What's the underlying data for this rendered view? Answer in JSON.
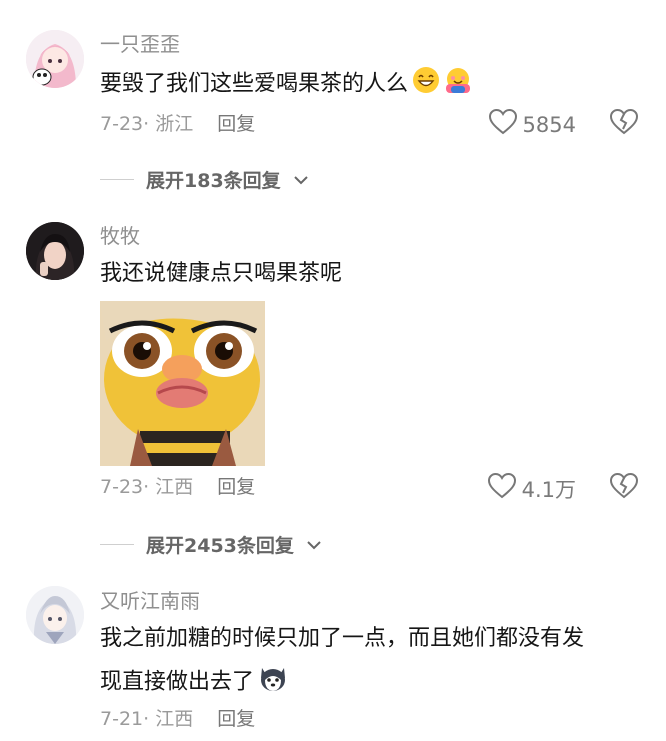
{
  "comments": [
    {
      "username": "一只歪歪",
      "text": "要毁了我们这些爱喝果茶的人么",
      "date": "7-23",
      "location": "浙江",
      "reply_label": "回复",
      "likes": "5854",
      "expand_label": "展开183条回复"
    },
    {
      "username": "牧牧",
      "text": "我还说健康点只喝果茶呢",
      "date": "7-23",
      "location": "江西",
      "reply_label": "回复",
      "likes": "4.1万",
      "expand_label": "展开2453条回复"
    },
    {
      "username": "又听江南雨",
      "text_line1": "我之前加糖的时候只加了一点，而且她们都没有发",
      "text_line2": "现直接做出去了",
      "date": "7-21",
      "location": "江西",
      "reply_label": "回复"
    }
  ],
  "icons": {
    "like": "heart-outline-icon",
    "dislike": "broken-heart-icon",
    "expand": "chevron-down-icon"
  },
  "colors": {
    "text": "#161616",
    "meta": "#9a9a9a"
  }
}
